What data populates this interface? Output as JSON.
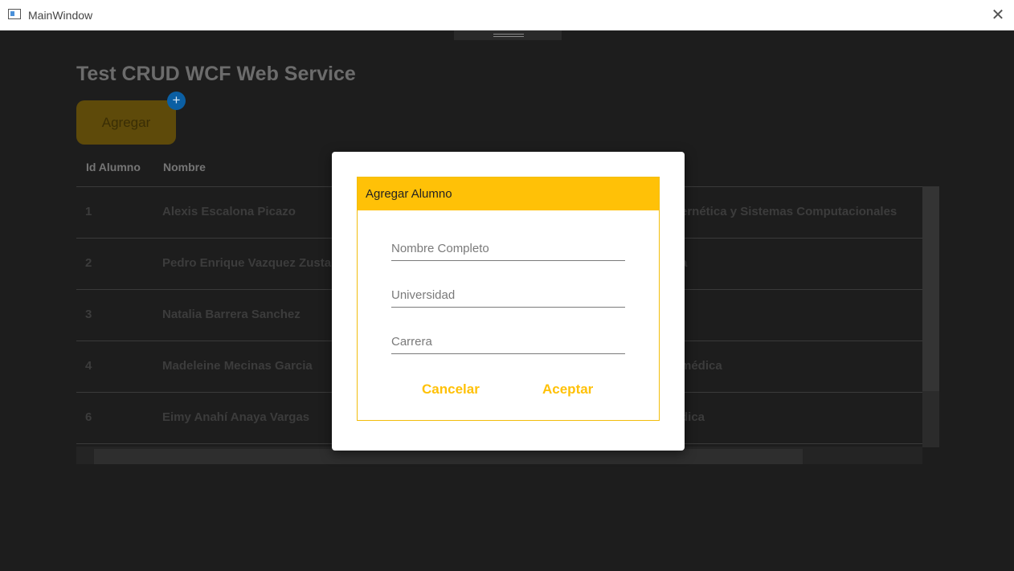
{
  "window": {
    "title": "MainWindow",
    "close": "✕"
  },
  "page": {
    "title": "Test CRUD WCF Web Service",
    "add_button": "Agregar",
    "add_badge": "+"
  },
  "table": {
    "headers": [
      "Id Alumno",
      "Nombre"
    ],
    "rows": [
      {
        "id": "1",
        "nombre": "Alexis Escalona Picazo",
        "carrera": "ernética y Sistemas Computacionales"
      },
      {
        "id": "2",
        "nombre": "Pedro Enrique Vazquez Zusta",
        "carrera": "a"
      },
      {
        "id": "3",
        "nombre": "Natalia Barrera Sanchez",
        "carrera": ""
      },
      {
        "id": "4",
        "nombre": "Madeleine Mecinas Garcia",
        "carrera": "médica"
      },
      {
        "id": "6",
        "nombre": "Eimy Anahí Anaya Vargas",
        "carrera": "dica"
      }
    ]
  },
  "dialog": {
    "title": "Agregar Alumno",
    "fields": [
      {
        "placeholder": "Nombre Completo",
        "value": ""
      },
      {
        "placeholder": "Universidad",
        "value": ""
      },
      {
        "placeholder": "Carrera",
        "value": ""
      }
    ],
    "cancel_label": "Cancelar",
    "accept_label": "Aceptar"
  },
  "colors": {
    "accent": "#ffc107",
    "badge": "#0b5fa3",
    "background": "#1d1d1d"
  }
}
